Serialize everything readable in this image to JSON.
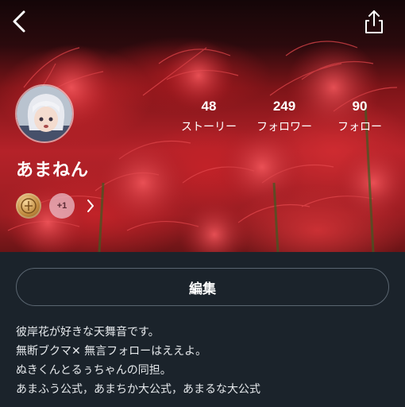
{
  "profile": {
    "username": "あまねん",
    "stats": [
      {
        "value": "48",
        "label": "ストーリー"
      },
      {
        "value": "249",
        "label": "フォロワー"
      },
      {
        "value": "90",
        "label": "フォロー"
      }
    ],
    "badges": {
      "more_count": "+1"
    },
    "edit_label": "編集",
    "bio_lines": [
      "彼岸花が好きな天舞音です。",
      "無断ブクマ✕ 無言フォローはええよ。",
      "ぬきくんとるぅちゃんの同担。",
      "あまふう公式，あまちか大公式，あまるな大公式"
    ]
  },
  "icons": {
    "back": "chevron-left-icon",
    "share": "share-icon",
    "badge_arrow": "chevron-right-icon"
  },
  "colors": {
    "background": "#1b232b",
    "header_red": "#b52229",
    "button_border": "#5a6570"
  }
}
